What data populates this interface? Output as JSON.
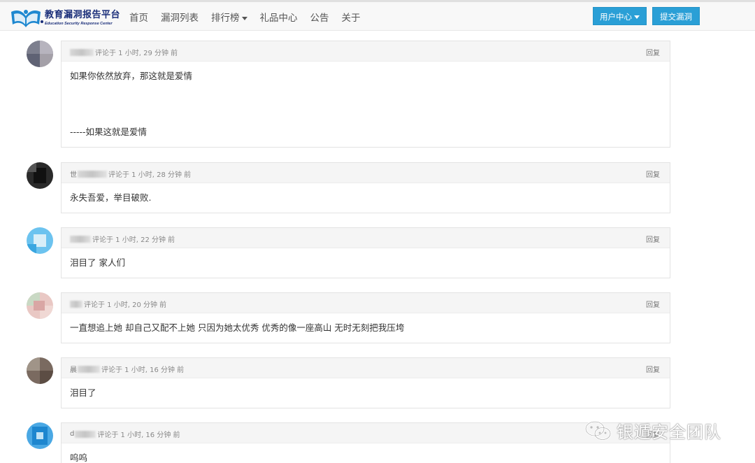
{
  "brand": {
    "title": "教育漏洞报告平台",
    "subtitle": "Education Security Response Center"
  },
  "nav": {
    "home": "首页",
    "vulns": "漏洞列表",
    "rank": "排行榜",
    "gifts": "礼品中心",
    "notice": "公告",
    "about": "关于"
  },
  "buttons": {
    "user_center": "用户中心",
    "submit_vuln": "提交漏洞"
  },
  "reply_label": "回复",
  "comments": [
    {
      "meta": "评论于 1 小时, 29 分钟 前",
      "lines": [
        "如果你依然放弃，那这就是爱情",
        "-----如果这就是爱情"
      ]
    },
    {
      "user_initial": "世",
      "meta": "评论于 1 小时, 28 分钟 前",
      "lines": [
        "永失吾爱，举目破败."
      ]
    },
    {
      "meta": "评论于 1 小时, 22 分钟 前",
      "lines": [
        "泪目了 家人们"
      ]
    },
    {
      "meta": "评论于 1 小时, 20 分钟 前",
      "lines": [
        "一直想追上她 却自己又配不上她 只因为她太优秀 优秀的像一座高山 无时无刻把我压垮"
      ]
    },
    {
      "user_initial": "晨",
      "meta": "评论于 1 小时, 16 分钟 前",
      "lines": [
        "泪目了"
      ]
    },
    {
      "user_initial": "d",
      "meta": "评论于 1 小时, 16 分钟 前",
      "lines": [
        "呜呜"
      ]
    }
  ],
  "watermark": "银遁安全团队",
  "colors": {
    "accent": "#2a9fd6",
    "brand": "#1b2f7a"
  }
}
